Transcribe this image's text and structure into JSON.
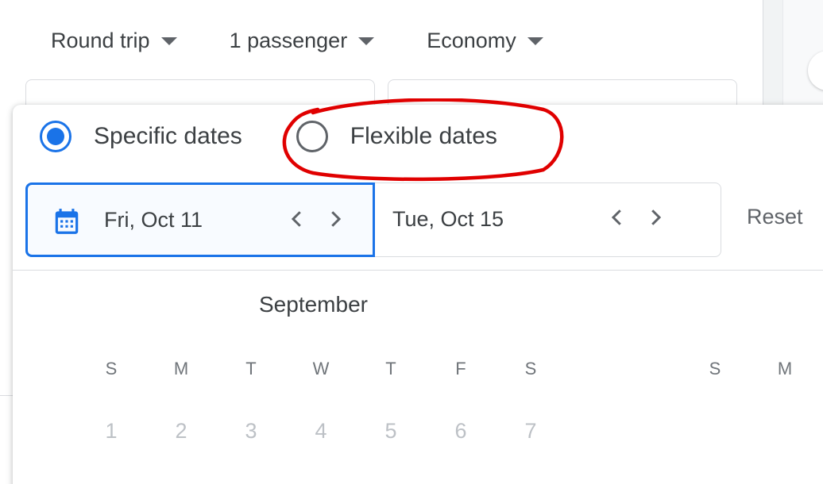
{
  "trip_options": [
    {
      "label": "Round trip"
    },
    {
      "label": "1 passenger"
    },
    {
      "label": "Economy"
    }
  ],
  "date_mode": {
    "specific_label": "Specific dates",
    "flexible_label": "Flexible dates",
    "selected": "specific"
  },
  "date_fields": {
    "departure": "Fri, Oct 11",
    "return": "Tue, Oct 15"
  },
  "reset_label": "Reset",
  "calendar": {
    "month": "September",
    "weekdays": [
      "S",
      "M",
      "T",
      "W",
      "T",
      "F",
      "S"
    ],
    "next_month_weekdays": [
      "S",
      "M"
    ],
    "days": [
      "1",
      "2",
      "3",
      "4",
      "5",
      "6",
      "7"
    ]
  },
  "colors": {
    "accent": "#1a73e8",
    "annotation": "#e00000",
    "text": "#3c4043",
    "muted_day": "#bdc1c6"
  },
  "icons": [
    "caret-down-icon",
    "calendar-icon",
    "chevron-left-icon",
    "chevron-right-icon"
  ]
}
